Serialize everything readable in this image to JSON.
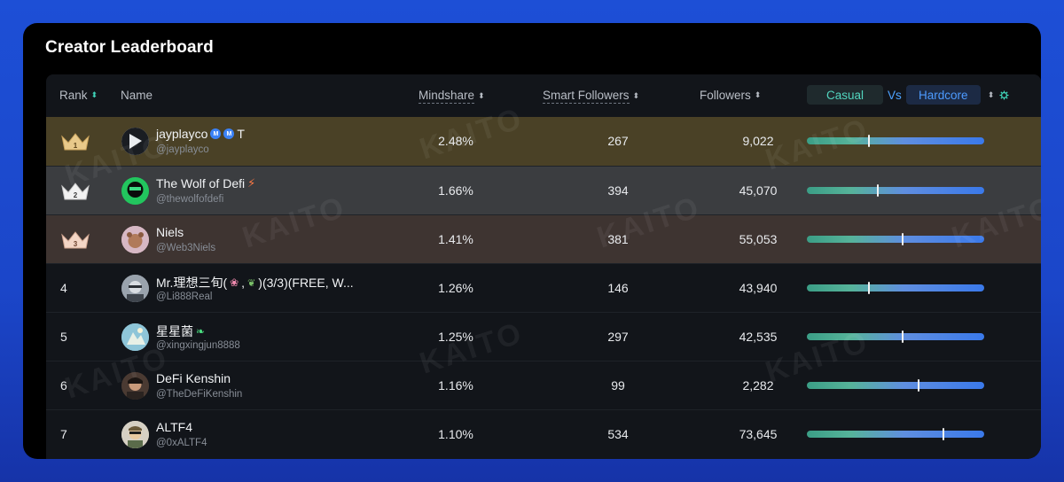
{
  "card": {
    "title": "Creator Leaderboard"
  },
  "columns": {
    "rank": "Rank",
    "name": "Name",
    "mindshare": "Mindshare",
    "smart_followers": "Smart Followers",
    "followers": "Followers",
    "casual": "Casual",
    "vs": "Vs",
    "hardcore": "Hardcore"
  },
  "watermark": "KAITO",
  "colors": {
    "row1_bg": "#4a4126",
    "row2_bg": "#3b3d40",
    "row3_bg": "#3e3431",
    "table_bg": "#12151a",
    "casual": "#52d6bf",
    "hardcore": "#4d9bff"
  },
  "rows": [
    {
      "rank": "1",
      "name": "jayplayco",
      "suffix": "T",
      "handle": "@jayplayco",
      "mindshare": "2.48%",
      "smart_followers": "267",
      "followers": "9,022",
      "casual_hardcore": 0.35
    },
    {
      "rank": "2",
      "name": "The Wolf of Defi",
      "suffix": "",
      "handle": "@thewolfofdefi",
      "mindshare": "1.66%",
      "smart_followers": "394",
      "followers": "45,070",
      "casual_hardcore": 0.4
    },
    {
      "rank": "3",
      "name": "Niels",
      "suffix": "",
      "handle": "@Web3Niels",
      "mindshare": "1.41%",
      "smart_followers": "381",
      "followers": "55,053",
      "casual_hardcore": 0.54
    },
    {
      "rank": "4",
      "name": "Mr.理想三旬(",
      "name_mid": ",",
      "name_end": ")(3/3)(FREE, W...",
      "handle": "@Li888Real",
      "mindshare": "1.26%",
      "smart_followers": "146",
      "followers": "43,940",
      "casual_hardcore": 0.35
    },
    {
      "rank": "5",
      "name": "星星菌",
      "suffix": "",
      "handle": "@xingxingjun8888",
      "mindshare": "1.25%",
      "smart_followers": "297",
      "followers": "42,535",
      "casual_hardcore": 0.54
    },
    {
      "rank": "6",
      "name": "DeFi Kenshin",
      "suffix": "",
      "handle": "@TheDeFiKenshin",
      "mindshare": "1.16%",
      "smart_followers": "99",
      "followers": "2,282",
      "casual_hardcore": 0.63
    },
    {
      "rank": "7",
      "name": "ALTF4",
      "suffix": "",
      "handle": "@0xALTF4",
      "mindshare": "1.10%",
      "smart_followers": "534",
      "followers": "73,645",
      "casual_hardcore": 0.77
    }
  ]
}
